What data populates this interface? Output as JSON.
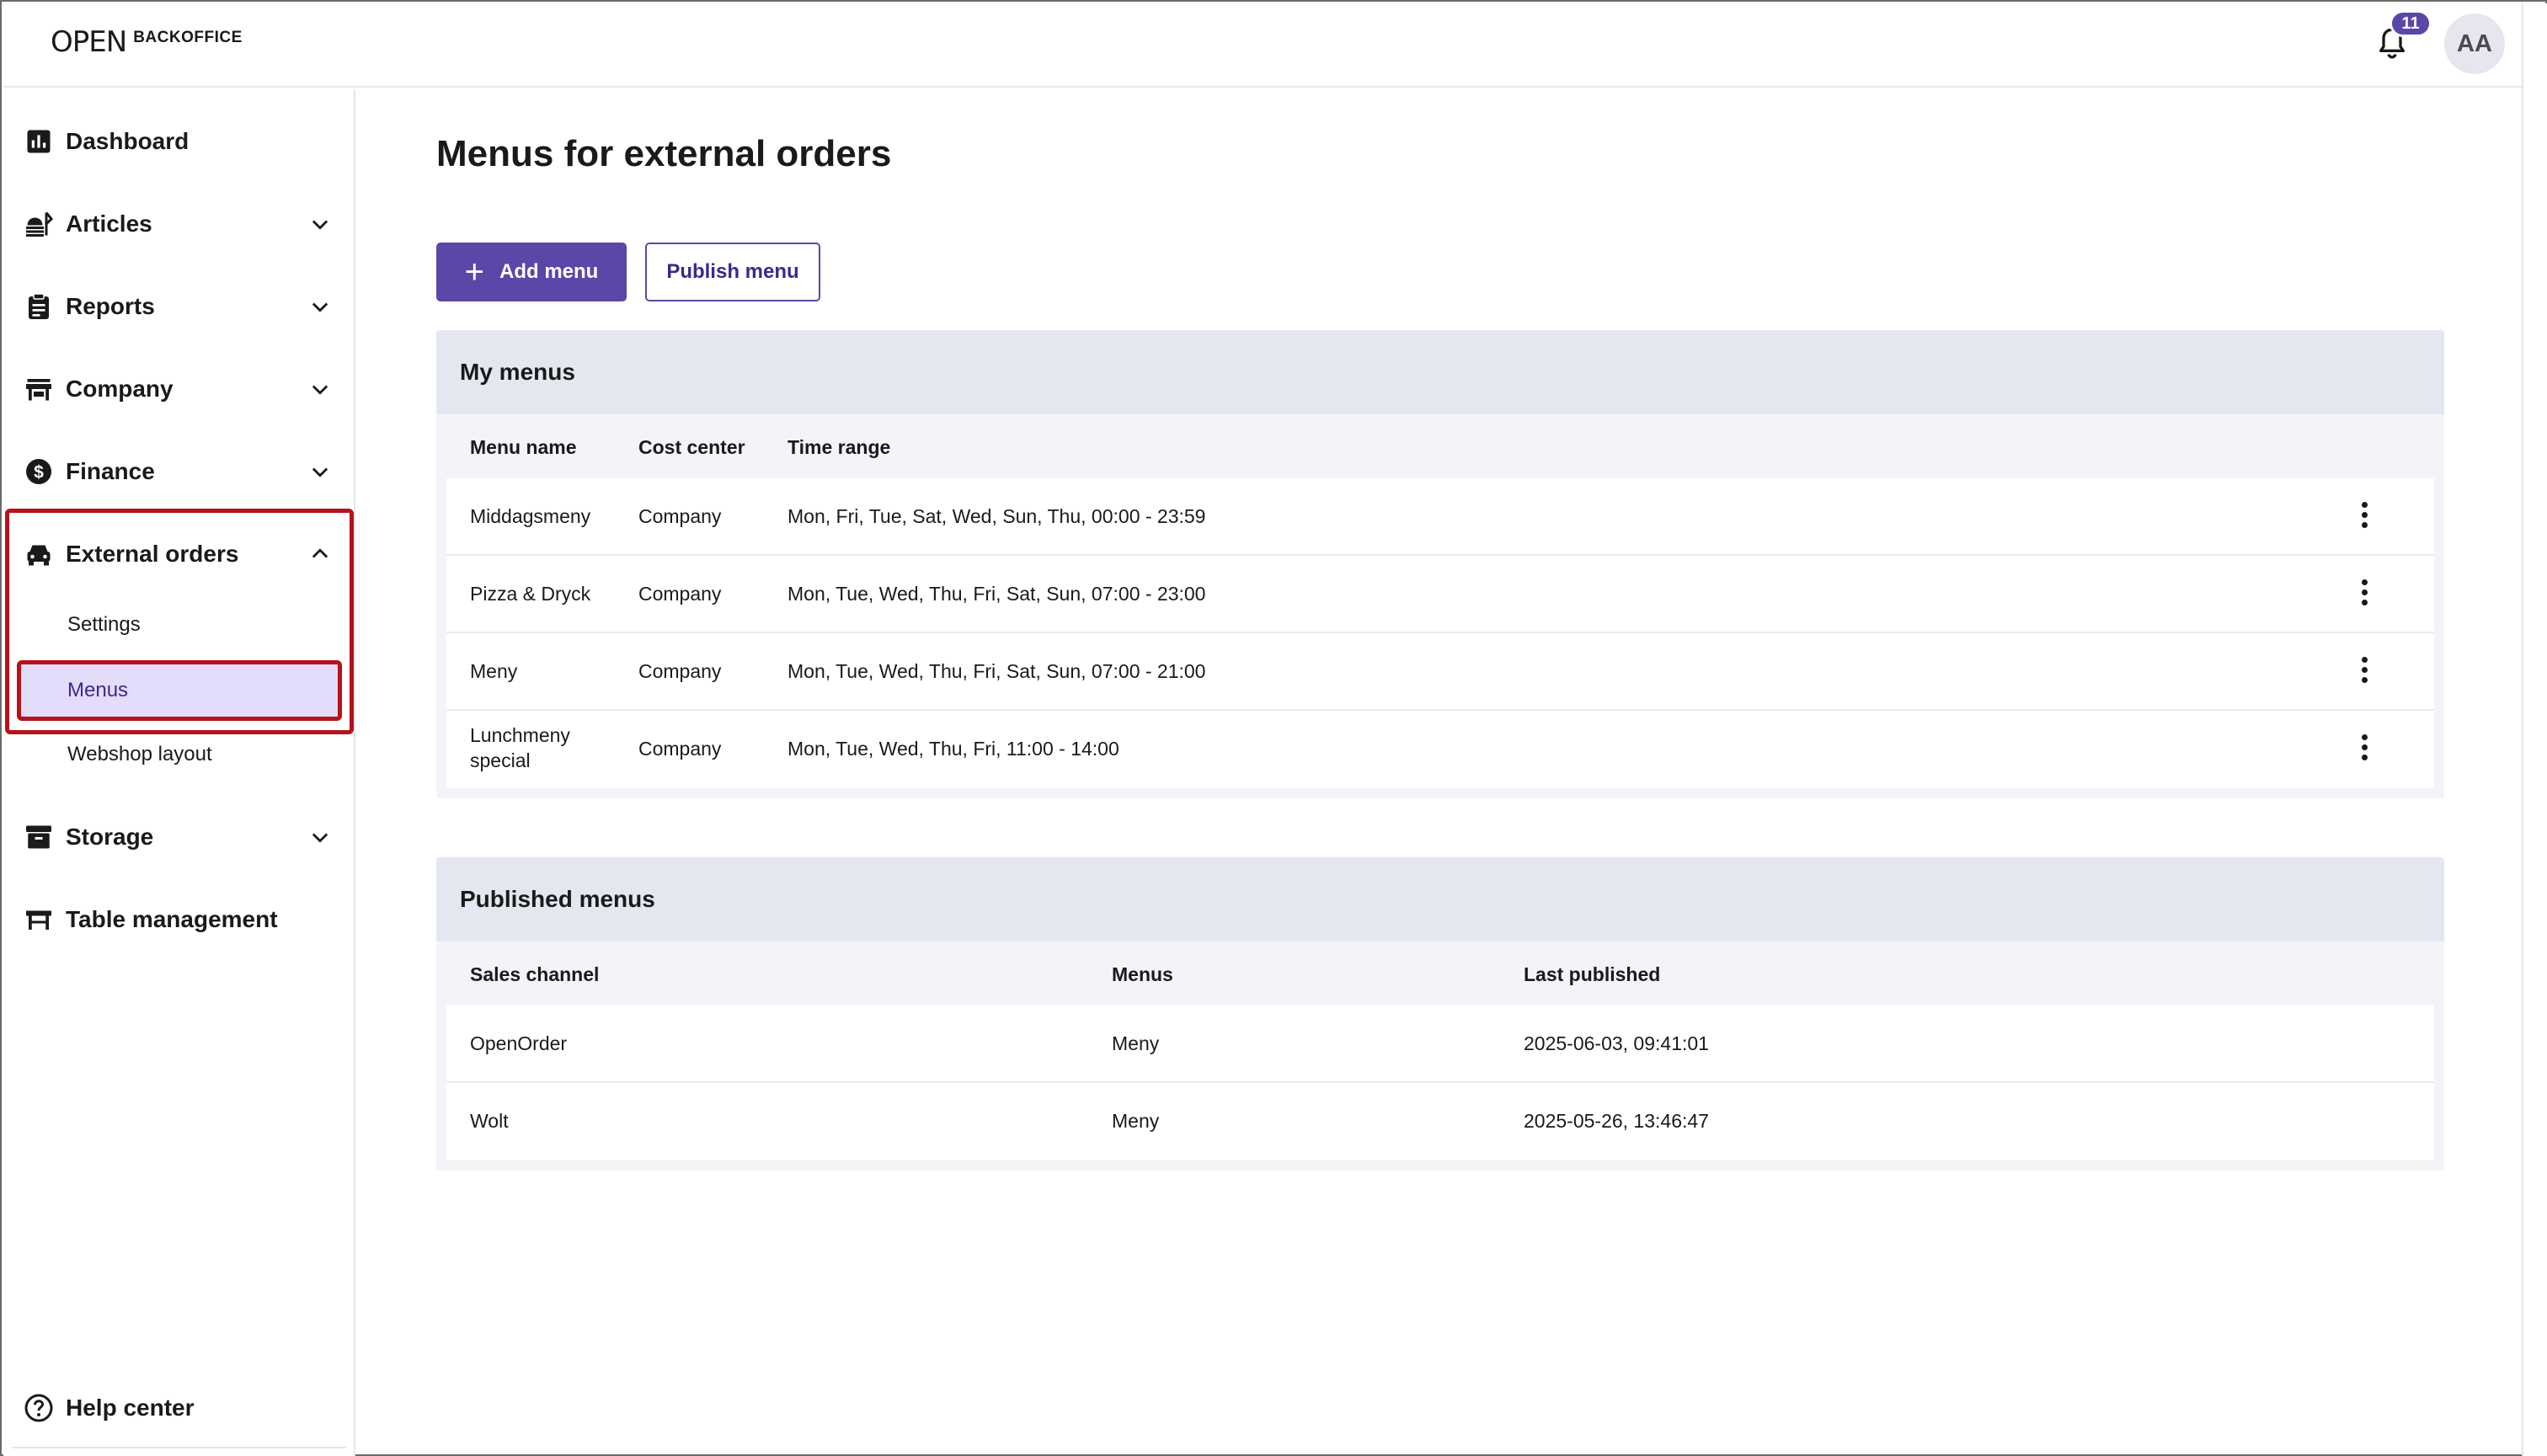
{
  "app": {
    "logo_mark": "OPEN",
    "logo_text": "BACKOFFICE",
    "notifications_count": "11",
    "avatar_initials": "AA"
  },
  "sidebar": {
    "items": [
      {
        "label": "Dashboard",
        "icon": "bar-chart-icon"
      },
      {
        "label": "Articles",
        "icon": "food-cloche-icon"
      },
      {
        "label": "Reports",
        "icon": "clipboard-icon"
      },
      {
        "label": "Company",
        "icon": "storefront-icon"
      },
      {
        "label": "Finance",
        "icon": "dollar-circle-icon"
      },
      {
        "label": "External orders",
        "icon": "car-icon",
        "expanded": true,
        "children": [
          {
            "label": "Settings"
          },
          {
            "label": "Menus",
            "active": true
          },
          {
            "label": "Webshop layout"
          }
        ]
      },
      {
        "label": "Storage",
        "icon": "archive-box-icon"
      },
      {
        "label": "Table management",
        "icon": "table-icon"
      }
    ],
    "help": {
      "label": "Help center",
      "icon": "help-circle-icon"
    }
  },
  "main": {
    "title": "Menus for external orders",
    "add_menu_label": "Add menu",
    "publish_menu_label": "Publish menu",
    "my_menus": {
      "title": "My menus",
      "columns": [
        "Menu name",
        "Cost center",
        "Time range"
      ],
      "rows": [
        {
          "name": "Middagsmeny",
          "cost_center": "Company",
          "time_range": "Mon, Fri, Tue, Sat, Wed, Sun, Thu, 00:00 - 23:59"
        },
        {
          "name": "Pizza & Dryck",
          "cost_center": "Company",
          "time_range": "Mon, Tue, Wed, Thu, Fri, Sat, Sun, 07:00 - 23:00"
        },
        {
          "name": "Meny",
          "cost_center": "Company",
          "time_range": "Mon, Tue, Wed, Thu, Fri, Sat, Sun, 07:00 - 21:00"
        },
        {
          "name_line1": "Lunchmeny",
          "name_line2": "special",
          "cost_center": "Company",
          "time_range": "Mon, Tue, Wed, Thu, Fri, 11:00 - 14:00"
        }
      ]
    },
    "published_menus": {
      "title": "Published menus",
      "columns": [
        "Sales channel",
        "Menus",
        "Last published"
      ],
      "rows": [
        {
          "channel": "OpenOrder",
          "menus": "Meny",
          "last_published": "2025-06-03, 09:41:01"
        },
        {
          "channel": "Wolt",
          "menus": "Meny",
          "last_published": "2025-05-26, 13:46:47"
        }
      ]
    }
  },
  "colors": {
    "accent": "#5b47a8",
    "active_bg": "#e4dcfb",
    "highlight": "#b5121b",
    "panel_head": "#e5e7f0"
  }
}
